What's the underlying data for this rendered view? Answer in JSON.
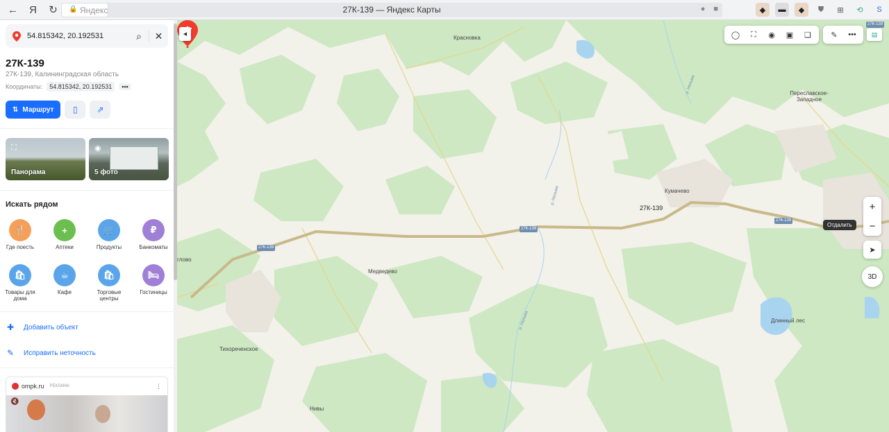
{
  "browser": {
    "nav": {
      "back": "←",
      "yandex_home": "Я",
      "reload": "↻"
    },
    "url_host": "Яндекс",
    "page_title": "27К-139 — Яндекс Карты"
  },
  "sidebar": {
    "search_value": "54.815342, 20.192531",
    "title": "27К-139",
    "subtitle": "27К-139, Калининградская область",
    "coords_label": "Координаты:",
    "coords_value": "54.815342, 20.192531",
    "coords_more": "•••",
    "route_label": "Маршрут",
    "photos": [
      {
        "label": "Панорама"
      },
      {
        "label": "5 фото"
      }
    ],
    "nearby_heading": "Искать рядом",
    "categories": [
      {
        "label": "Где поесть",
        "color": "#f5a05a",
        "glyph": "🍴"
      },
      {
        "label": "Аптеки",
        "color": "#6cbf4f",
        "glyph": "+"
      },
      {
        "label": "Продукты",
        "color": "#5aa5ea",
        "glyph": "🛒"
      },
      {
        "label": "Банкоматы",
        "color": "#a07fd6",
        "glyph": "₽"
      },
      {
        "label": "Товары для дома",
        "color": "#5aa5ea",
        "glyph": "🛍"
      },
      {
        "label": "Кафе",
        "color": "#5aa5ea",
        "glyph": "☕"
      },
      {
        "label": "Торговые центры",
        "color": "#5aa5ea",
        "glyph": "🛍"
      },
      {
        "label": "Гостиницы",
        "color": "#a07fd6",
        "glyph": "🛏"
      }
    ],
    "add_object": "Добавить объект",
    "fix_error": "Исправить неточность",
    "ad": {
      "domain": "ompk.ru",
      "label": "РЕКЛАМА"
    }
  },
  "map": {
    "pin_label": "27К-139",
    "road_badges": [
      "27К-139",
      "27К-139",
      "27К-139",
      "27К-139"
    ],
    "places": [
      {
        "name": "Красновка"
      },
      {
        "name": "Кумачево"
      },
      {
        "name": "Переславское-Западное"
      },
      {
        "name": "Медведево"
      },
      {
        "name": "Тихореченское"
      },
      {
        "name": "Нивы"
      },
      {
        "name": "Длинный лес"
      },
      {
        "name": "глово"
      },
      {
        "name": "р. Нельма"
      },
      {
        "name": "р. Нельма"
      },
      {
        "name": "р. Нельма"
      }
    ],
    "tooltip": "Отдалить",
    "zoom_in": "+",
    "zoom_out": "−",
    "btn_3d": "3D",
    "colors": {
      "forest": "#cde8c2",
      "field": "#f2f1ea",
      "road": "#c9b98a",
      "water": "#a9d4f0",
      "pin": "#f03c2e"
    }
  }
}
